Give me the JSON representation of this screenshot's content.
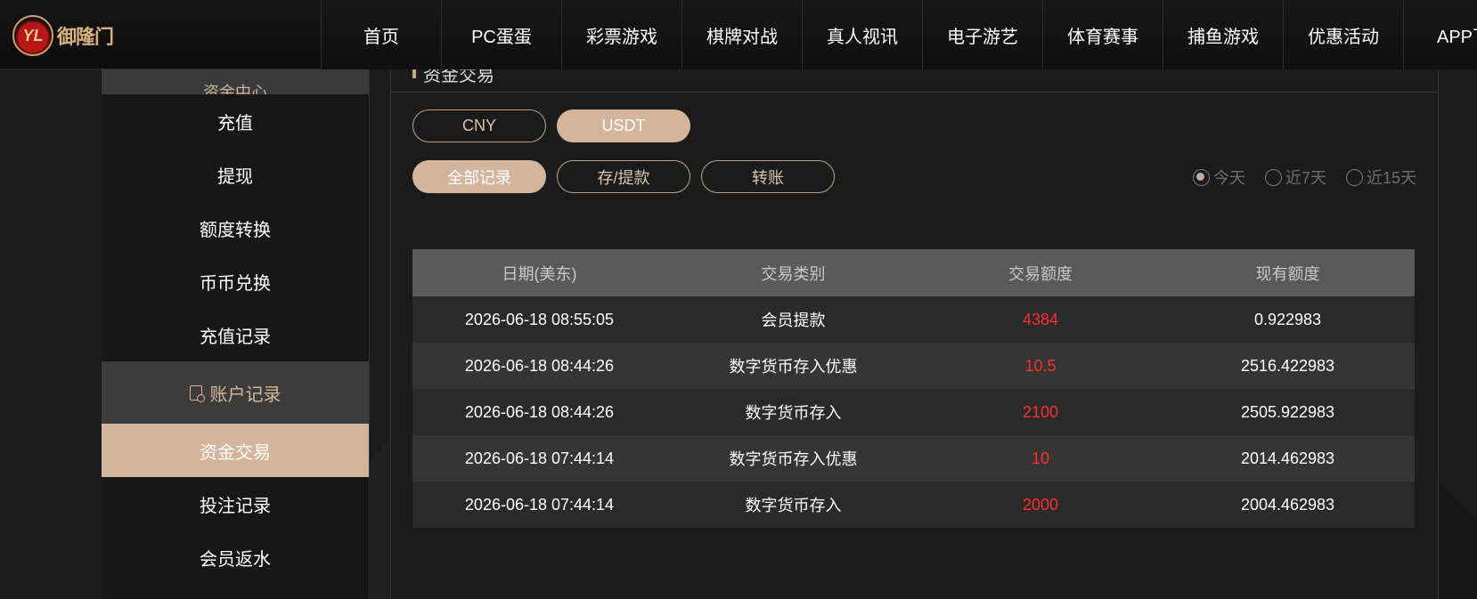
{
  "header": {
    "logo_mark": "YL",
    "logo_text": "御隆门",
    "nav": [
      "首页",
      "PC蛋蛋",
      "彩票游戏",
      "棋牌对战",
      "真人视讯",
      "电子游艺",
      "体育赛事",
      "捕鱼游戏",
      "优惠活动",
      "APP下"
    ]
  },
  "sidebar": {
    "top_label": "资金中心",
    "items_a": [
      "充值",
      "提现",
      "额度转换",
      "币币兑换",
      "充值记录"
    ],
    "group_label": "账户记录",
    "items_b": [
      "资金交易",
      "投注记录",
      "会员返水"
    ],
    "active_item": "资金交易"
  },
  "panel": {
    "title": "资金交易",
    "currency_tabs": [
      "CNY",
      "USDT"
    ],
    "currency_selected": "USDT",
    "type_tabs": [
      "全部记录",
      "存/提款",
      "转账"
    ],
    "type_selected": "全部记录",
    "ranges": [
      "今天",
      "近7天",
      "近15天"
    ],
    "range_selected": "今天"
  },
  "table": {
    "headers": [
      "日期(美东)",
      "交易类别",
      "交易额度",
      "现有额度"
    ],
    "rows": [
      [
        "2026-06-18 08:55:05",
        "会员提款",
        "4384",
        "0.922983"
      ],
      [
        "2026-06-18 08:44:26",
        "数字货币存入优惠",
        "10.5",
        "2516.422983"
      ],
      [
        "2026-06-18 08:44:26",
        "数字货币存入",
        "2100",
        "2505.922983"
      ],
      [
        "2026-06-18 07:44:14",
        "数字货币存入优惠",
        "10",
        "2014.462983"
      ],
      [
        "2026-06-18 07:44:14",
        "数字货币存入",
        "2000",
        "2004.462983"
      ]
    ]
  },
  "colors": {
    "accent": "#d4b59b",
    "amount_red": "#ff2d2d"
  }
}
